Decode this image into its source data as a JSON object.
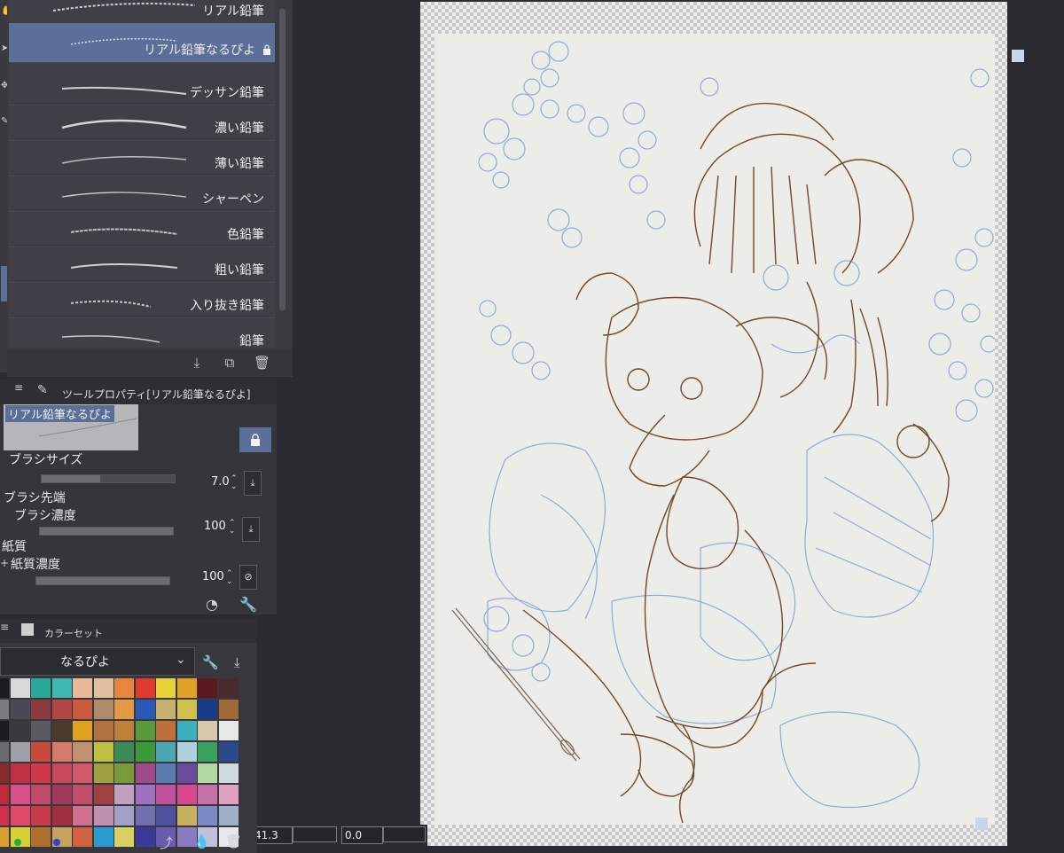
{
  "brush_list": {
    "items": [
      {
        "label": "リアル鉛筆",
        "selected": false
      },
      {
        "label": "リアル鉛筆なるぴよ",
        "selected": true,
        "locked": true
      },
      {
        "label": "デッサン鉛筆",
        "selected": false
      },
      {
        "label": "濃い鉛筆",
        "selected": false
      },
      {
        "label": "薄い鉛筆",
        "selected": false
      },
      {
        "label": "シャーペン",
        "selected": false
      },
      {
        "label": "色鉛筆",
        "selected": false
      },
      {
        "label": "粗い鉛筆",
        "selected": false
      },
      {
        "label": "入り抜き鉛筆",
        "selected": false
      },
      {
        "label": "鉛筆",
        "selected": false
      }
    ]
  },
  "tool_property": {
    "title": "ツールプロパティ[リアル鉛筆なるぴよ]",
    "preview_label": "リアル鉛筆なるぴよ",
    "brush_size_label": "ブラシサイズ",
    "brush_size_value": "7.0",
    "brush_tip_label": "ブラシ先端",
    "brush_density_label": "ブラシ濃度",
    "brush_density_value": "100",
    "paper_texture_label": "紙質",
    "paper_density_label": "紙質濃度",
    "paper_density_value": "100"
  },
  "color_set": {
    "title": "カラーセット",
    "selected_set": "なるぴよ",
    "swatches": [
      [
        "#1b1a1f",
        "#d9d9d9",
        "#2aa89a",
        "#3fb8b0",
        "#e8b89a",
        "#e0bfa0",
        "#e8863e",
        "#e23a2c",
        "#e8d23a",
        "#e0a326",
        "#5a1a20",
        "#4a2a2e"
      ],
      [
        "#7a7a80",
        "#4a4a55",
        "#8a3c3c",
        "#b04848",
        "#cc5a3c",
        "#b08a6a",
        "#e29a46",
        "#2a5ab8",
        "#c8b070",
        "#d0c050",
        "#1a3a8a",
        "#a06a3a"
      ],
      [
        "#1a1a22",
        "#3a3a3e",
        "#5a5a60",
        "#4a3a2a",
        "#e0a020",
        "#b07040",
        "#c0803a",
        "#5a9a3a",
        "#c0703a",
        "#3ab0c0",
        "#d8c8a8",
        "#e8e8e8"
      ],
      [
        "#6a6a70",
        "#a0a0a8",
        "#c84a3a",
        "#d87a6a",
        "#c09070",
        "#c0c040",
        "#3a8a5a",
        "#3a9a3a",
        "#4aa8b0",
        "#b0d0e0",
        "#3aa060",
        "#2a4a8a"
      ],
      [
        "#8a2a2a",
        "#c03040",
        "#d03848",
        "#c84a5a",
        "#d05a6a",
        "#a0a040",
        "#7a9a3a",
        "#a04a8a",
        "#5a7ab0",
        "#6a4a9a",
        "#b0d8a0",
        "#d0d8e0"
      ],
      [
        "#c02a3a",
        "#d8508a",
        "#c04a6a",
        "#a03a5a",
        "#c0506a",
        "#a04040",
        "#c0a0c0",
        "#a070c0",
        "#c050a0",
        "#d84a90",
        "#c870a8",
        "#e0a0c0"
      ],
      [
        "#d0304a",
        "#e04a6a",
        "#c83a4a",
        "#a03040",
        "#d07090",
        "#c090b0",
        "#a0a0c8",
        "#7070b0",
        "#5050a0",
        "#c8b060",
        "#7a8ac8",
        "#a0b0c8"
      ],
      [
        "#d8a030",
        "#d8d030",
        "#b07030",
        "#c8a060",
        "#d06040",
        "#2a9ad0",
        "#d8d060",
        "#3a3a9a",
        "#6a5ab0",
        "#8a7ac0",
        "#c0c0d8",
        "#e8e8ec"
      ]
    ]
  },
  "status_bar": {
    "zoom_value": "41.3",
    "rotate_value": "0.0"
  }
}
